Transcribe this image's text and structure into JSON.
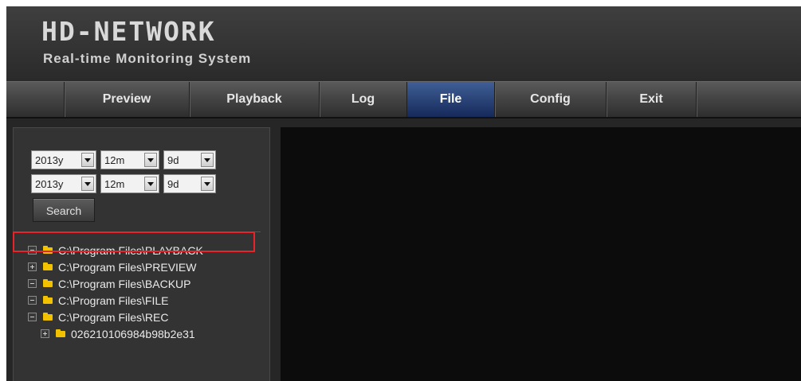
{
  "header": {
    "logo_title": "HD-NETWORK",
    "logo_subtitle": "Real-time Monitoring System"
  },
  "nav": {
    "items": [
      {
        "label": "Preview"
      },
      {
        "label": "Playback"
      },
      {
        "label": "Log"
      },
      {
        "label": "File",
        "active": true
      },
      {
        "label": "Config"
      },
      {
        "label": "Exit"
      }
    ]
  },
  "search": {
    "start": {
      "year": "2013y",
      "month": "12m",
      "day": "9d"
    },
    "end": {
      "year": "2013y",
      "month": "12m",
      "day": "9d"
    },
    "button_label": "Search"
  },
  "tree": {
    "items": [
      {
        "label": "C:\\Program Files\\PLAYBACK",
        "toggle": "minus",
        "selected": true
      },
      {
        "label": "C:\\Program Files\\PREVIEW",
        "toggle": "plus"
      },
      {
        "label": "C:\\Program Files\\BACKUP",
        "toggle": "minus"
      },
      {
        "label": "C:\\Program Files\\FILE",
        "toggle": "minus"
      },
      {
        "label": "C:\\Program Files\\REC",
        "toggle": "minus"
      },
      {
        "label": "026210106984b98b2e31",
        "toggle": "plus",
        "child": true
      }
    ]
  },
  "colors": {
    "active_tab": "#2a4a86",
    "highlight": "#e8242a",
    "folder": "#f2c200"
  }
}
